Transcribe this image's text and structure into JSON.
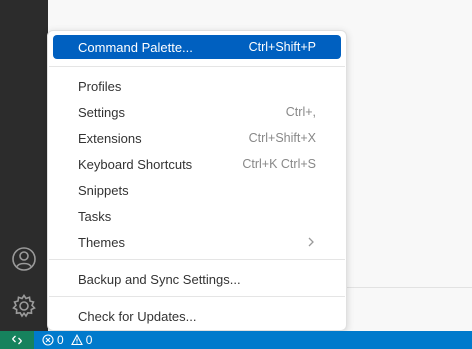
{
  "activity_bar": {
    "accounts_icon": "account-icon",
    "manage_icon": "gear-icon"
  },
  "menu": {
    "items": [
      {
        "label": "Command Palette...",
        "shortcut": "Ctrl+Shift+P",
        "active": true
      },
      {
        "label": "Profiles",
        "shortcut": ""
      },
      {
        "label": "Settings",
        "shortcut": "Ctrl+,"
      },
      {
        "label": "Extensions",
        "shortcut": "Ctrl+Shift+X"
      },
      {
        "label": "Keyboard Shortcuts",
        "shortcut": "Ctrl+K Ctrl+S"
      },
      {
        "label": "Snippets",
        "shortcut": ""
      },
      {
        "label": "Tasks",
        "shortcut": ""
      },
      {
        "label": "Themes",
        "shortcut": "",
        "submenu_icon": "chevron-right-icon"
      },
      {
        "label": "Backup and Sync Settings...",
        "shortcut": ""
      },
      {
        "label": "Check for Updates...",
        "shortcut": ""
      }
    ]
  },
  "status_bar": {
    "remote_icon": "remote-icon",
    "errors_count": "0",
    "warnings_count": "0",
    "errors_icon": "error-icon",
    "warnings_icon": "warning-icon"
  },
  "colors": {
    "accent": "#0060c0",
    "status_bar": "#007acc",
    "remote": "#16825d",
    "activity_bar": "#2c2c2c"
  }
}
